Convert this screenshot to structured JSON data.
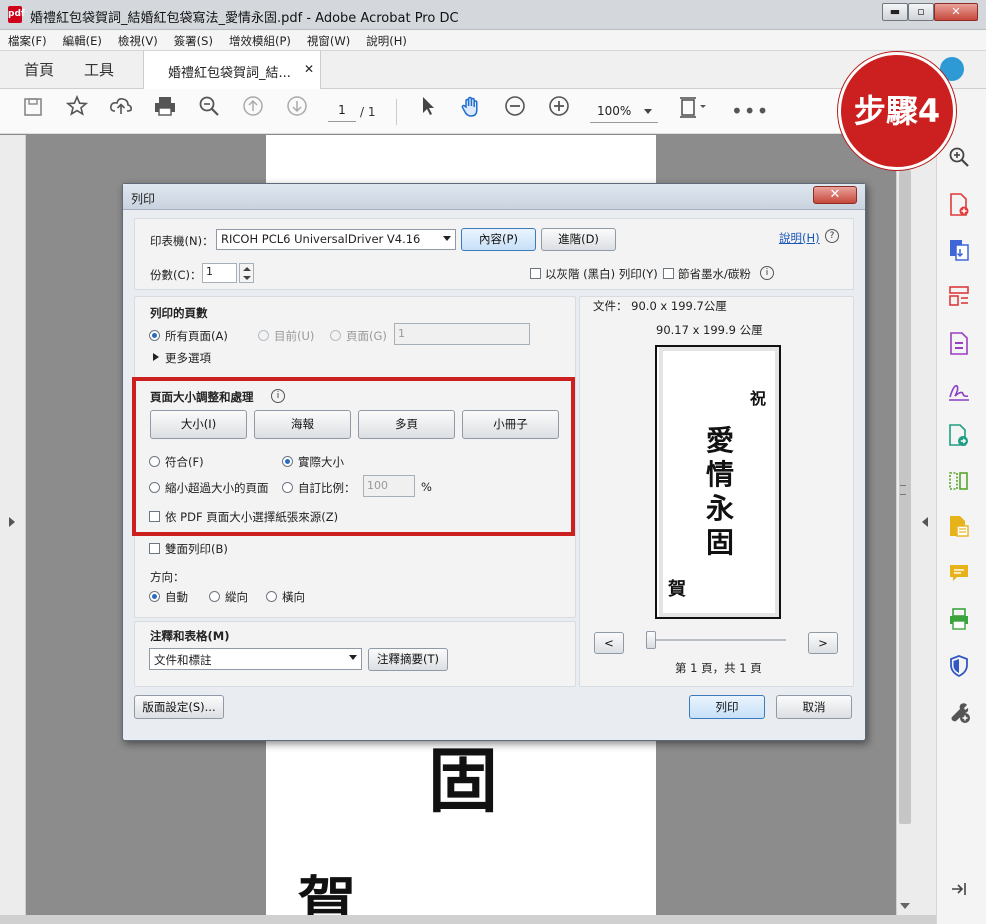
{
  "window": {
    "title": "婚禮紅包袋賀詞_結婚紅包袋寫法_愛情永固.pdf - Adobe Acrobat Pro DC",
    "pdf_icon": "pdf",
    "buttons": {
      "minimize": "▬",
      "maximize": "▫",
      "close": "✕"
    }
  },
  "menu": [
    "檔案(F)",
    "編輯(E)",
    "檢視(V)",
    "簽署(S)",
    "增效模組(P)",
    "視窗(W)",
    "說明(H)"
  ],
  "tabs": {
    "home": "首頁",
    "tools": "工具",
    "document": "婚禮紅包袋賀詞_結...",
    "close": "✕"
  },
  "toolbar": {
    "page_current": "1",
    "page_total": "/ 1",
    "zoom": "100%"
  },
  "badge": "步驟4",
  "background_chars": {
    "char1": "固",
    "char2": "賀"
  },
  "dialog": {
    "title": "列印",
    "close": "✕",
    "printer_label": "印表機(N)：",
    "printer_value": "RICOH PCL6 UniversalDriver V4.16",
    "properties_button": "內容(P)",
    "advanced_button": "進階(D)",
    "help_link": "說明(H)",
    "copies_label": "份數(C)：",
    "copies_value": "1",
    "grayscale_label": "以灰階 (黑白) 列印(Y)",
    "save_ink_label": "節省墨水/碳粉",
    "pages_section": {
      "heading": "列印的頁數",
      "all": "所有頁面(A)",
      "current": "目前(U)",
      "pages": "頁面(G)",
      "pages_value": "1",
      "more": "更多選項"
    },
    "sizing_section": {
      "heading": "頁面大小調整和處理",
      "size_button": "大小(I)",
      "poster_button": "海報",
      "multiple_button": "多頁",
      "booklet_button": "小冊子",
      "fit": "符合(F)",
      "actual": "實際大小",
      "shrink": "縮小超過大小的頁面",
      "custom": "自訂比例：",
      "custom_value": "100",
      "percent": "%",
      "choose_source": "依 PDF 頁面大小選擇紙張來源(Z)"
    },
    "duplex_label": "雙面列印(B)",
    "orientation": {
      "heading": "方向：",
      "auto": "自動",
      "portrait": "縱向",
      "landscape": "橫向"
    },
    "comments": {
      "heading": "注釋和表格(M)",
      "value": "文件和標註",
      "summary_button": "注釋摘要(T)"
    },
    "page_setup_button": "版面設定(S)...",
    "preview": {
      "doc_size": "文件： 90.0 x 199.7公厘",
      "paper_size": "90.17 x 199.9 公厘",
      "chars": {
        "zhu": "祝",
        "ai": "愛",
        "qing": "情",
        "yong": "永",
        "gu": "固",
        "he": "賀"
      },
      "prev_button": "<",
      "next_button": ">",
      "page_info": "第 1 頁，共 1 頁"
    },
    "print_button": "列印",
    "cancel_button": "取消"
  },
  "colors": {
    "accent": "#2a6bc4",
    "badge_red": "#cc1f1f",
    "highlight": "#cc1f1f"
  }
}
